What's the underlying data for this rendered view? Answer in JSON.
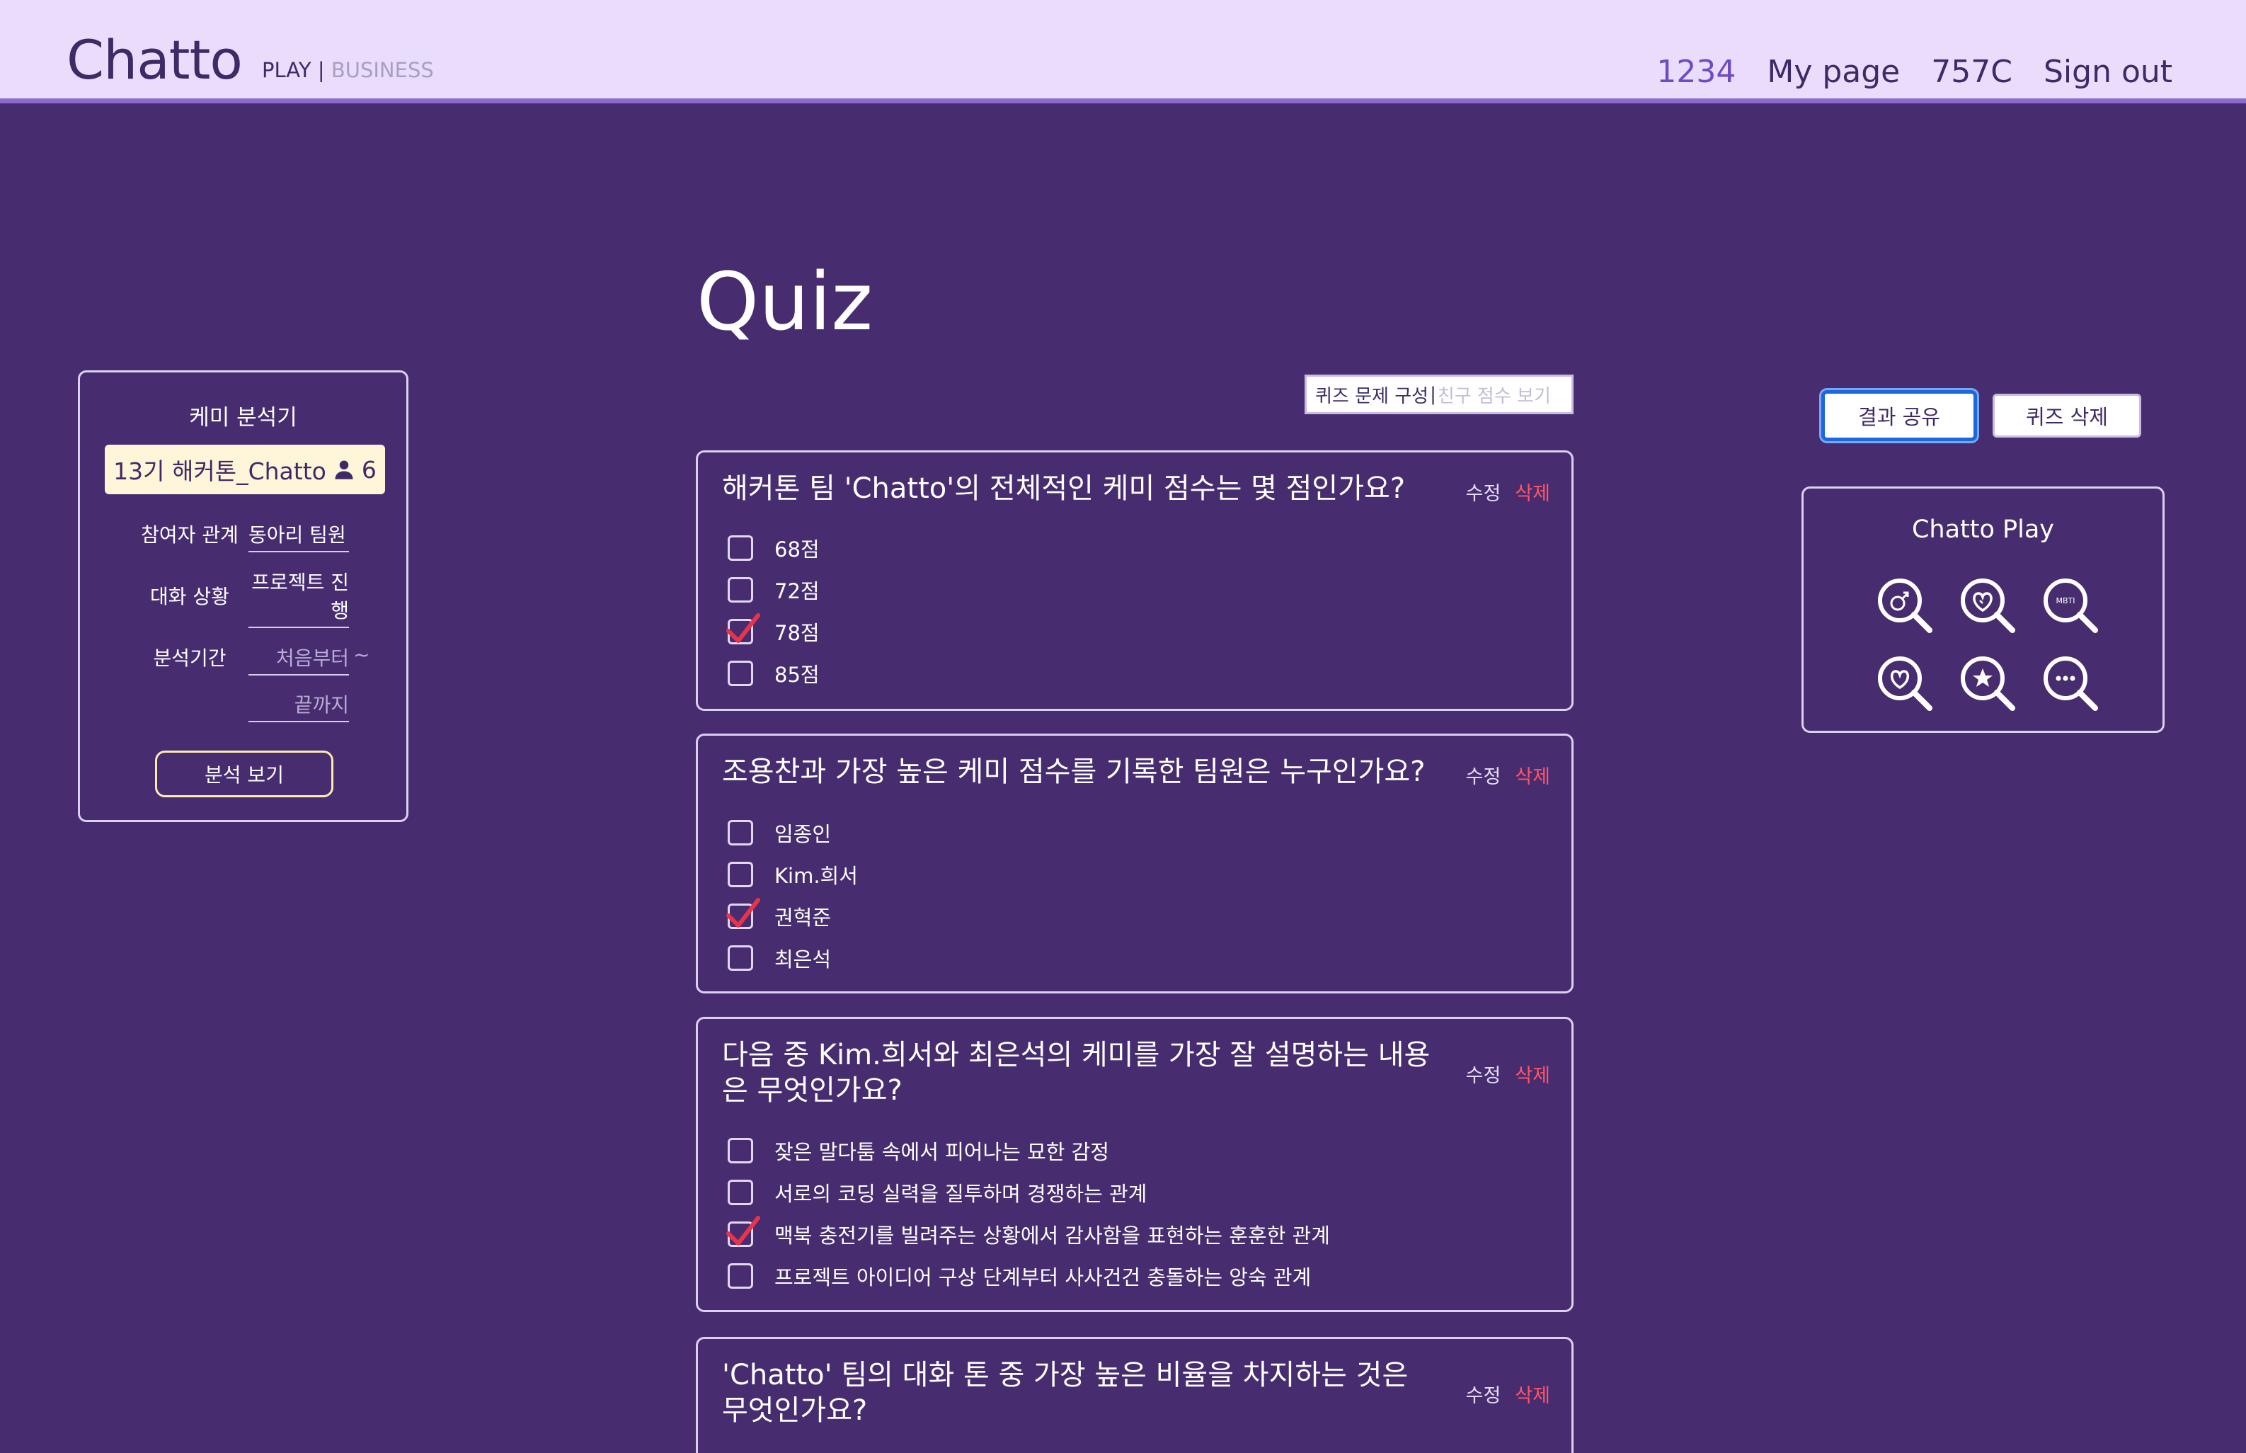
{
  "header": {
    "logo": "Chatto",
    "play": "PLAY",
    "separator": "|",
    "business": "BUSINESS",
    "nav": [
      "1234",
      "My page",
      "757C",
      "Sign out"
    ]
  },
  "page": {
    "title": "Quiz"
  },
  "analyzer": {
    "title": "케미 분석기",
    "room": "13기 해커톤_Chatto",
    "member_count": "6",
    "relation_label": "참여자 관계",
    "relation_value": "동아리 팀원",
    "situation_label": "대화 상황",
    "situation_value_line1": "프로젝트 진",
    "situation_value_line2": "행",
    "period_label": "분석기간",
    "start_placeholder": "처음부터",
    "tilde": "~",
    "end_placeholder": "끝까지",
    "analyze_button": "분석 보기"
  },
  "toggle": {
    "active": "퀴즈 문제 구성",
    "separator": "|",
    "inactive": "친구 점수 보기"
  },
  "quiz": {
    "edit_label": "수정",
    "delete_label": "삭제",
    "questions": [
      {
        "text": "해커톤 팀 'Chatto'의 전체적인 케미 점수는 몇 점인가요?",
        "options": [
          "68점",
          "72점",
          "78점",
          "85점"
        ],
        "checked": [
          false,
          false,
          true,
          false
        ]
      },
      {
        "text": "조용찬과 가장 높은 케미 점수를 기록한 팀원은 누구인가요?",
        "options": [
          "임종인",
          "Kim.희서",
          "권혁준",
          "최은석"
        ],
        "checked": [
          false,
          false,
          true,
          false
        ]
      },
      {
        "text": "다음 중 Kim.희서와 최은석의 케미를 가장 잘 설명하는 내용은 무엇인가요?",
        "options": [
          "잦은 말다툼 속에서 피어나는 묘한 감정",
          "서로의 코딩 실력을 질투하며 경쟁하는 관계",
          "맥북 충전기를 빌려주는 상황에서 감사함을 표현하는 훈훈한 관계",
          "프로젝트 아이디어 구상 단계부터 사사건건 충돌하는 앙숙 관계"
        ],
        "checked": [
          false,
          false,
          true,
          false
        ]
      },
      {
        "text": "'Chatto' 팀의 대화 톤 중 가장 높은 비율을 차지하는 것은 무엇인가요?",
        "options": [],
        "checked": []
      }
    ]
  },
  "actions": {
    "share": "결과 공유",
    "delete_quiz": "퀴즈 삭제"
  },
  "play_panel": {
    "title": "Chatto Play",
    "icons": [
      "gender-search-icon",
      "heart-search-icon",
      "mbti-search-icon",
      "heart-search-icon",
      "star-search-icon",
      "chat-search-icon"
    ],
    "mbti_text": "MBTI"
  },
  "colors": {
    "background": "#472d70",
    "header": "#eadcfb",
    "accent_purple": "#6f4bc1",
    "delete_red": "#ff5566",
    "check_red": "#e8344a",
    "share_focus": "#1a67e0"
  }
}
